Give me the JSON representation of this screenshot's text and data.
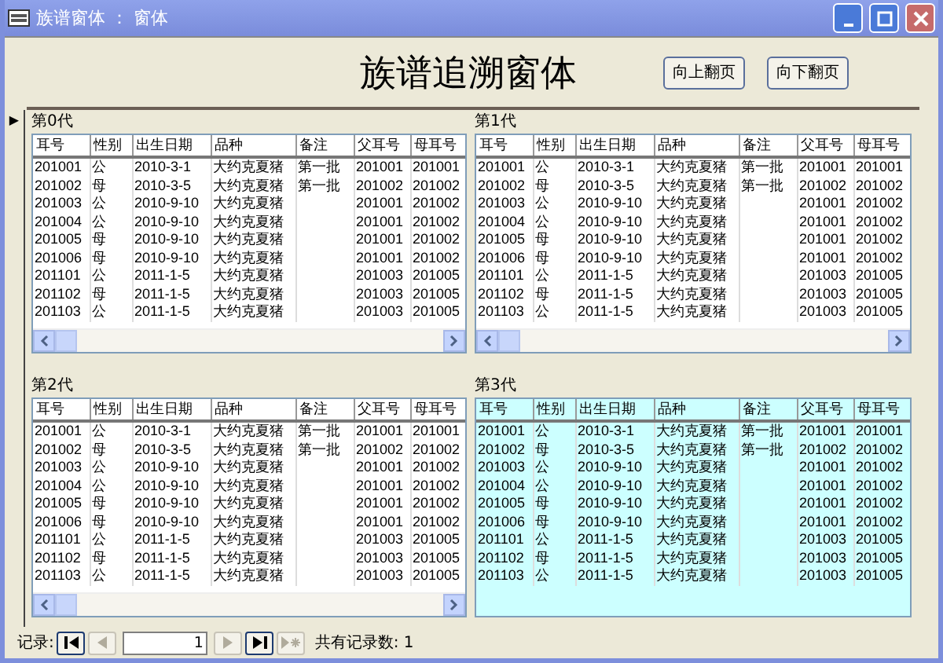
{
  "window": {
    "title": "族谱窗体 ： 窗体"
  },
  "heading": "族谱追溯窗体",
  "buttons": [
    {
      "label": "向上翻页"
    },
    {
      "label": "向下翻页"
    }
  ],
  "record_selector": "▶",
  "grids": [
    {
      "title": "第0代",
      "selected": false,
      "columns": [
        "耳号",
        "性别",
        "出生日期",
        "品种",
        "备注",
        "父耳号",
        "母耳号"
      ],
      "rows": [
        [
          "201001",
          "公",
          "2010-3-1",
          "大约克夏猪",
          "第一批",
          "201001",
          "201001"
        ],
        [
          "201002",
          "母",
          "2010-3-5",
          "大约克夏猪",
          "第一批",
          "201002",
          "201002"
        ],
        [
          "201003",
          "公",
          "2010-9-10",
          "大约克夏猪",
          null,
          "201001",
          "201002"
        ],
        [
          "201004",
          "公",
          "2010-9-10",
          "大约克夏猪",
          null,
          "201001",
          "201002"
        ],
        [
          "201005",
          "母",
          "2010-9-10",
          "大约克夏猪",
          null,
          "201001",
          "201002"
        ],
        [
          "201006",
          "母",
          "2010-9-10",
          "大约克夏猪",
          null,
          "201001",
          "201002"
        ],
        [
          "201101",
          "公",
          "2011-1-5",
          "大约克夏猪",
          null,
          "201003",
          "201005"
        ],
        [
          "201102",
          "母",
          "2011-1-5",
          "大约克夏猪",
          null,
          "201003",
          "201005"
        ],
        [
          "201103",
          "公",
          "2011-1-5",
          "大约克夏猪",
          null,
          "201003",
          "201005"
        ]
      ]
    },
    {
      "title": "第1代",
      "selected": false,
      "columns": [
        "耳号",
        "性别",
        "出生日期",
        "品种",
        "备注",
        "父耳号",
        "母耳号"
      ],
      "rows": [
        [
          "201001",
          "公",
          "2010-3-1",
          "大约克夏猪",
          "第一批",
          "201001",
          "201001"
        ],
        [
          "201002",
          "母",
          "2010-3-5",
          "大约克夏猪",
          "第一批",
          "201002",
          "201002"
        ],
        [
          "201003",
          "公",
          "2010-9-10",
          "大约克夏猪",
          null,
          "201001",
          "201002"
        ],
        [
          "201004",
          "公",
          "2010-9-10",
          "大约克夏猪",
          null,
          "201001",
          "201002"
        ],
        [
          "201005",
          "母",
          "2010-9-10",
          "大约克夏猪",
          null,
          "201001",
          "201002"
        ],
        [
          "201006",
          "母",
          "2010-9-10",
          "大约克夏猪",
          null,
          "201001",
          "201002"
        ],
        [
          "201101",
          "公",
          "2011-1-5",
          "大约克夏猪",
          null,
          "201003",
          "201005"
        ],
        [
          "201102",
          "母",
          "2011-1-5",
          "大约克夏猪",
          null,
          "201003",
          "201005"
        ],
        [
          "201103",
          "公",
          "2011-1-5",
          "大约克夏猪",
          null,
          "201003",
          "201005"
        ]
      ]
    },
    {
      "title": "第2代",
      "selected": false,
      "columns": [
        "耳号",
        "性别",
        "出生日期",
        "品种",
        "备注",
        "父耳号",
        "母耳号"
      ],
      "rows": [
        [
          "201001",
          "公",
          "2010-3-1",
          "大约克夏猪",
          "第一批",
          "201001",
          "201001"
        ],
        [
          "201002",
          "母",
          "2010-3-5",
          "大约克夏猪",
          "第一批",
          "201002",
          "201002"
        ],
        [
          "201003",
          "公",
          "2010-9-10",
          "大约克夏猪",
          null,
          "201001",
          "201002"
        ],
        [
          "201004",
          "公",
          "2010-9-10",
          "大约克夏猪",
          null,
          "201001",
          "201002"
        ],
        [
          "201005",
          "母",
          "2010-9-10",
          "大约克夏猪",
          null,
          "201001",
          "201002"
        ],
        [
          "201006",
          "母",
          "2010-9-10",
          "大约克夏猪",
          null,
          "201001",
          "201002"
        ],
        [
          "201101",
          "公",
          "2011-1-5",
          "大约克夏猪",
          null,
          "201003",
          "201005"
        ],
        [
          "201102",
          "母",
          "2011-1-5",
          "大约克夏猪",
          null,
          "201003",
          "201005"
        ],
        [
          "201103",
          "公",
          "2011-1-5",
          "大约克夏猪",
          null,
          "201003",
          "201005"
        ]
      ]
    },
    {
      "title": "第3代",
      "selected": true,
      "columns": [
        "耳号",
        "性别",
        "出生日期",
        "品种",
        "备注",
        "父耳号",
        "母耳号"
      ],
      "rows": [
        [
          "201001",
          "公",
          "2010-3-1",
          "大约克夏猪",
          "第一批",
          "201001",
          "201001"
        ],
        [
          "201002",
          "母",
          "2010-3-5",
          "大约克夏猪",
          "第一批",
          "201002",
          "201002"
        ],
        [
          "201003",
          "公",
          "2010-9-10",
          "大约克夏猪",
          null,
          "201001",
          "201002"
        ],
        [
          "201004",
          "公",
          "2010-9-10",
          "大约克夏猪",
          null,
          "201001",
          "201002"
        ],
        [
          "201005",
          "母",
          "2010-9-10",
          "大约克夏猪",
          null,
          "201001",
          "201002"
        ],
        [
          "201006",
          "母",
          "2010-9-10",
          "大约克夏猪",
          null,
          "201001",
          "201002"
        ],
        [
          "201101",
          "公",
          "2011-1-5",
          "大约克夏猪",
          null,
          "201003",
          "201005"
        ],
        [
          "201102",
          "母",
          "2011-1-5",
          "大约克夏猪",
          null,
          "201003",
          "201005"
        ],
        [
          "201103",
          "公",
          "2011-1-5",
          "大约克夏猪",
          null,
          "201003",
          "201005"
        ]
      ]
    }
  ],
  "navigation": {
    "label": "记录:",
    "current": "1",
    "buttons": [
      {
        "kind": "first",
        "disabled": false
      },
      {
        "kind": "prev",
        "disabled": true
      },
      {
        "kind": "next",
        "disabled": true
      },
      {
        "kind": "last",
        "disabled": false
      },
      {
        "kind": "new",
        "disabled": true
      }
    ],
    "total": "共有记录数: 1"
  }
}
